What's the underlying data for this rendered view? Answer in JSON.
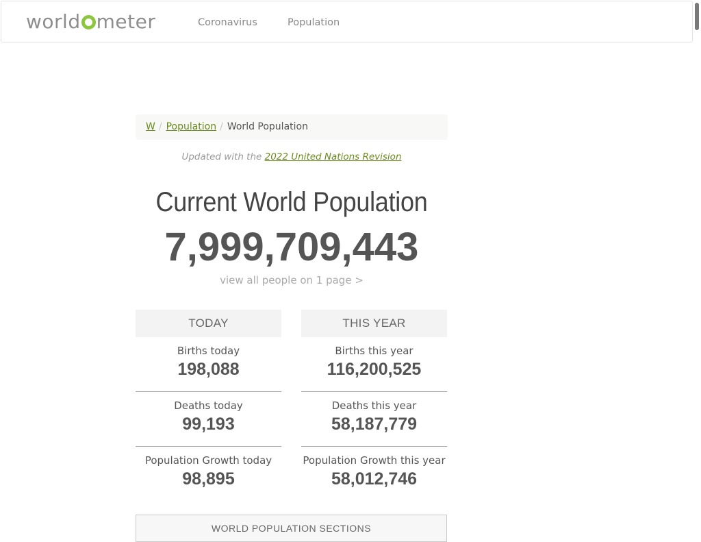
{
  "navbar": {
    "logo": {
      "before": "world",
      "after": "meter"
    },
    "links": [
      {
        "label": "Coronavirus"
      },
      {
        "label": "Population"
      }
    ]
  },
  "breadcrumb": {
    "home": "W",
    "parent": "Population",
    "current": "World Population",
    "separator": "/"
  },
  "updated": {
    "prefix": "Updated with the",
    "link_text": "2022 United Nations Revision"
  },
  "main": {
    "title": "Current World Population",
    "counter": "7,999,709,443",
    "view_all": "view all people on 1 page >"
  },
  "today": {
    "heading": "TODAY",
    "stats": [
      {
        "label": "Births today",
        "value": "198,088"
      },
      {
        "label": "Deaths today",
        "value": "99,193"
      },
      {
        "label": "Population Growth today",
        "value": "98,895"
      }
    ]
  },
  "this_year": {
    "heading": "THIS YEAR",
    "stats": [
      {
        "label": "Births this year",
        "value": "116,200,525"
      },
      {
        "label": "Deaths this year",
        "value": "58,187,779"
      },
      {
        "label": "Population Growth this year",
        "value": "58,012,746"
      }
    ]
  },
  "sections_box": {
    "title": "WORLD POPULATION SECTIONS"
  },
  "colors": {
    "brand_green": "#8cc63f",
    "link_green": "#6a8c1b",
    "text_gray": "#555555"
  }
}
